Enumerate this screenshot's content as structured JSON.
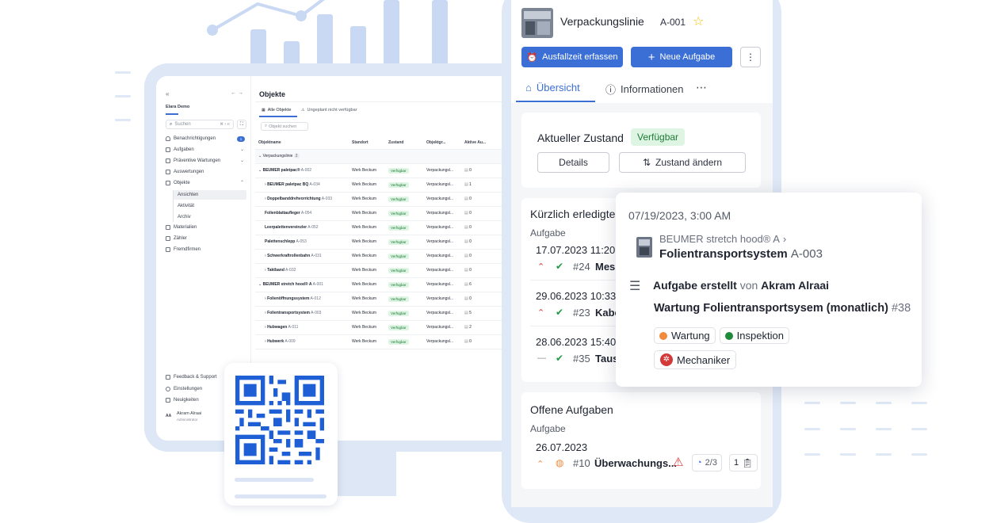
{
  "sidebar": {
    "org": "Elara Demo",
    "search_placeholder": "Suchen",
    "shortcut": "⌘ + K",
    "notification_count": "1",
    "items": [
      {
        "label": "Benachrichtigungen"
      },
      {
        "label": "Aufgaben"
      },
      {
        "label": "Präventive Wartungen"
      },
      {
        "label": "Auswertungen"
      },
      {
        "label": "Objekte"
      }
    ],
    "sub_items": [
      "Ansichten",
      "Aktivität",
      "Archiv"
    ],
    "more_items": [
      "Materialien",
      "Zähler",
      "Fremdfirmen"
    ],
    "bottom_items": [
      "Feedback & Support",
      "Einstellungen",
      "Neuigkeiten"
    ],
    "user": {
      "initials": "AA",
      "name": "Akram Alraai",
      "role": "Administrator"
    }
  },
  "objects": {
    "title": "Objekte",
    "tabs": [
      "Alle Objekte",
      "Ungeplant nicht verfügbar"
    ],
    "search_placeholder": "Objekt suchen",
    "columns": [
      "Objektname",
      "Standort",
      "Zustand",
      "Objektgr...",
      "Aktive Au..."
    ],
    "group": {
      "name": "Verpackungslinie",
      "count": "2"
    },
    "rows": [
      {
        "name": "BEUMER paletpac®",
        "code": "A-002",
        "loc": "Werk Beckum",
        "state": "Verfügbar",
        "grp": "Verpackungsl...",
        "active": "0"
      },
      {
        "name": "BEUMER paletpac BQ",
        "code": "A-034",
        "loc": "Werk Beckum",
        "state": "Verfügbar",
        "grp": "Verpackungsl...",
        "active": "1"
      },
      {
        "name": "Doppelbanddrehvorrichtung",
        "code": "A-033",
        "loc": "Werk Beckum",
        "state": "Verfügbar",
        "grp": "Verpackungsl...",
        "active": "0"
      },
      {
        "name": "Folienblattaufleger",
        "code": "A-054",
        "loc": "Werk Beckum",
        "state": "Verfügbar",
        "grp": "Verpackungsl...",
        "active": "0"
      },
      {
        "name": "Leerpalettenvereinzler",
        "code": "A-052",
        "loc": "Werk Beckum",
        "state": "Verfügbar",
        "grp": "Verpackungsl...",
        "active": "0"
      },
      {
        "name": "Palettenschlepp",
        "code": "A-053",
        "loc": "Werk Beckum",
        "state": "Verfügbar",
        "grp": "Verpackungsl...",
        "active": "0"
      },
      {
        "name": "Schwerkraftrollenbahn",
        "code": "A-031",
        "loc": "Werk Beckum",
        "state": "Verfügbar",
        "grp": "Verpackungsl...",
        "active": "0"
      },
      {
        "name": "Taktband",
        "code": "A-032",
        "loc": "Werk Beckum",
        "state": "Verfügbar",
        "grp": "Verpackungsl...",
        "active": "0"
      },
      {
        "name": "BEUMER stretch hood® A",
        "code": "A-001",
        "loc": "Werk Beckum",
        "state": "Verfügbar",
        "grp": "Verpackungsl...",
        "active": "6"
      },
      {
        "name": "Folienöffnungssystem",
        "code": "A-012",
        "loc": "Werk Beckum",
        "state": "Verfügbar",
        "grp": "Verpackungsl...",
        "active": "0"
      },
      {
        "name": "Folientransportsystem",
        "code": "A-003",
        "loc": "Werk Beckum",
        "state": "Verfügbar",
        "grp": "Verpackungsl...",
        "active": "5"
      },
      {
        "name": "Hubwagen",
        "code": "A-011",
        "loc": "Werk Beckum",
        "state": "Verfügbar",
        "grp": "Verpackungsl...",
        "active": "2"
      },
      {
        "name": "Hubwerk",
        "code": "A-009",
        "loc": "Werk Beckum",
        "state": "Verfügbar",
        "grp": "Verpackungsl...",
        "active": "0"
      }
    ]
  },
  "phone": {
    "title": "Verpackungslinie",
    "code": "A-001",
    "btn_downtime": "Ausfallzeit erfassen",
    "btn_new_task": "Neue Aufgabe",
    "tabs": [
      "Übersicht",
      "Informationen"
    ],
    "state_label": "Aktueller Zustand",
    "state_value": "Verfügbar",
    "btn_details": "Details",
    "btn_change_state": "Zustand ändern",
    "recent_title": "Kürzlich erledigte",
    "recent_sub": "Aufgabe",
    "recent": [
      {
        "date": "17.07.2023",
        "time": "11:20",
        "num": "#24",
        "text": "Mess"
      },
      {
        "date": "29.06.2023",
        "time": "10:33",
        "num": "#23",
        "text": "Kabe"
      },
      {
        "date": "28.06.2023",
        "time": "15:40",
        "num": "#35",
        "text": "Taus"
      }
    ],
    "open_title": "Offene Aufgaben",
    "open_sub": "Aufgabe",
    "open": {
      "date": "26.07.2023",
      "num": "#10",
      "text": "Überwachungs...",
      "progress": "2/3",
      "count": "1"
    }
  },
  "popover": {
    "timestamp": "07/19/2023, 3:00 AM",
    "parent": "BEUMER stretch hood® A",
    "object": "Folientransportsystem",
    "object_code": "A-003",
    "action": "Aufgabe erstellt",
    "by": "von",
    "user": "Akram Alraai",
    "task": "Wartung Folientransportsysem (monatlich)",
    "task_num": "#38",
    "tags": [
      {
        "label": "Wartung",
        "color": "#f08a3c"
      },
      {
        "label": "Inspektion",
        "color": "#1e8a3a"
      }
    ],
    "team": "Mechaniker"
  },
  "colors": {
    "accent": "#3b6fd6",
    "bg_deco": "#c9d9f3",
    "success": "#1e7a36"
  }
}
